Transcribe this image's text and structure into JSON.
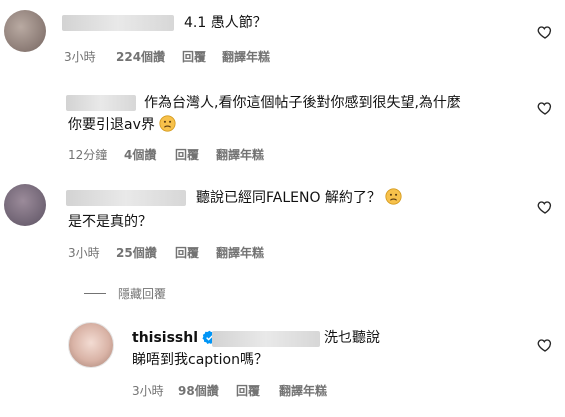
{
  "comments": [
    {
      "text_line1": "4.1 愚人節？",
      "time": "3小時",
      "likes": "224個讚",
      "reply": "回覆",
      "translate": "翻譯年糕"
    },
    {
      "text_line1": "作為台灣人,看你這個帖子後對你感到很失望,為什麼",
      "text_line2": "你要引退av界",
      "time": "12分鐘",
      "likes": "4個讚",
      "reply": "回覆",
      "translate": "翻譯年糕"
    },
    {
      "text_line1": "聽說已經同FALENO 解約了？",
      "text_line2": "是不是真的？",
      "time": "3小時",
      "likes": "25個讚",
      "reply": "回覆",
      "translate": "翻譯年糕"
    }
  ],
  "hide_replies": "隱藏回覆",
  "reply_comment": {
    "username": "thisisshl",
    "text_line1_tail": "洗乜聽說",
    "text_line2": "睇唔到我caption嗎？",
    "time": "3小時",
    "likes": "98個讚",
    "reply": "回覆",
    "translate": "翻譯年糕"
  },
  "colors": {
    "meta": "#737373",
    "verified": "#0095f6"
  },
  "icons": {
    "like": "heart-outline-icon",
    "verified": "verified-badge-icon",
    "emoji": "sad-face-icon"
  }
}
